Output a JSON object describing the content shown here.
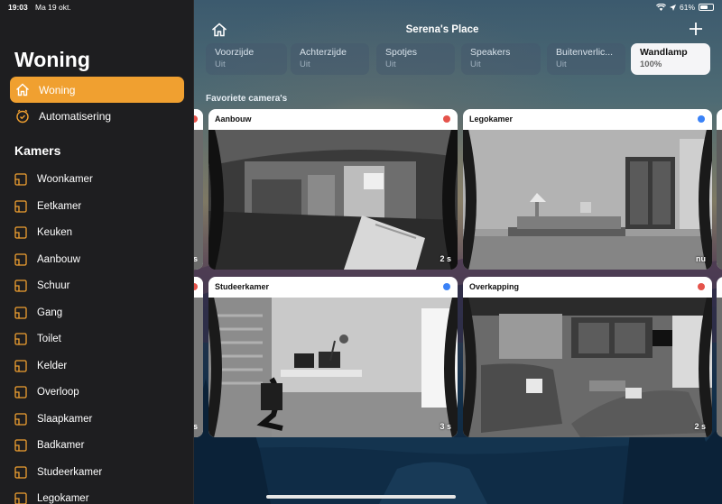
{
  "status_bar": {
    "time": "19:03",
    "date": "Ma 19 okt.",
    "battery": "61%"
  },
  "sidebar": {
    "title": "Woning",
    "nav": [
      {
        "label": "Woning",
        "icon": "home-icon",
        "active": true
      },
      {
        "label": "Automatisering",
        "icon": "clock-check-icon",
        "active": false
      }
    ],
    "section_title": "Kamers",
    "rooms": [
      "Woonkamer",
      "Eetkamer",
      "Keuken",
      "Aanbouw",
      "Schuur",
      "Gang",
      "Toilet",
      "Kelder",
      "Overloop",
      "Slaapkamer",
      "Badkamer",
      "Studeerkamer",
      "Legokamer"
    ]
  },
  "header": {
    "title": "Serena's Place",
    "home_icon": "home-icon",
    "add_icon": "plus-icon"
  },
  "tiles": [
    {
      "name": "Voorzijde",
      "state": "Uit",
      "on": false
    },
    {
      "name": "Achterzijde",
      "state": "Uit",
      "on": false
    },
    {
      "name": "Spotjes",
      "state": "Uit",
      "on": false
    },
    {
      "name": "Speakers",
      "state": "Uit",
      "on": false
    },
    {
      "name": "Buitenverlic...",
      "state": "Uit",
      "on": false
    },
    {
      "name": "Wandlamp",
      "state": "100%",
      "on": true
    }
  ],
  "favorites_label": "Favoriete camera's",
  "cameras": [
    {
      "name": "Aanbouw",
      "time": "2 s",
      "dot": "#e5534b"
    },
    {
      "name": "Legokamer",
      "time": "nu",
      "dot": "#3a82f7"
    },
    {
      "name": "Studeerkamer",
      "time": "3 s",
      "dot": "#3a82f7"
    },
    {
      "name": "Overkapping",
      "time": "2 s",
      "dot": "#e5534b"
    }
  ],
  "partial_cameras": {
    "left_time_top": "s",
    "left_time_bottom": "s"
  }
}
